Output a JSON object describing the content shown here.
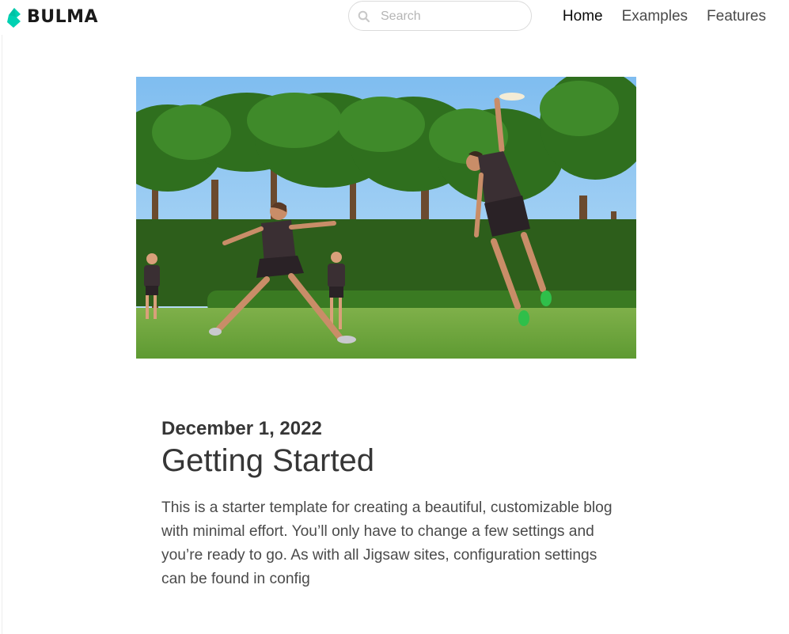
{
  "brand": {
    "name": "BULMA",
    "color": "#00d1b2"
  },
  "search": {
    "placeholder": "Search",
    "value": ""
  },
  "nav": {
    "items": [
      {
        "label": "Home",
        "active": true
      },
      {
        "label": "Examples",
        "active": false
      },
      {
        "label": "Features",
        "active": false
      }
    ]
  },
  "post": {
    "image": "Ultimate frisbee players on a grass field in a park, one leaping to catch a disc",
    "date": "December 1, 2022",
    "title": "Getting Started",
    "excerpt": "This is a starter template for creating a beautiful, customizable blog with minimal effort. You’ll only have to change a few settings and you’re ready to go. As with all Jigsaw sites, configuration settings can be found in config"
  }
}
